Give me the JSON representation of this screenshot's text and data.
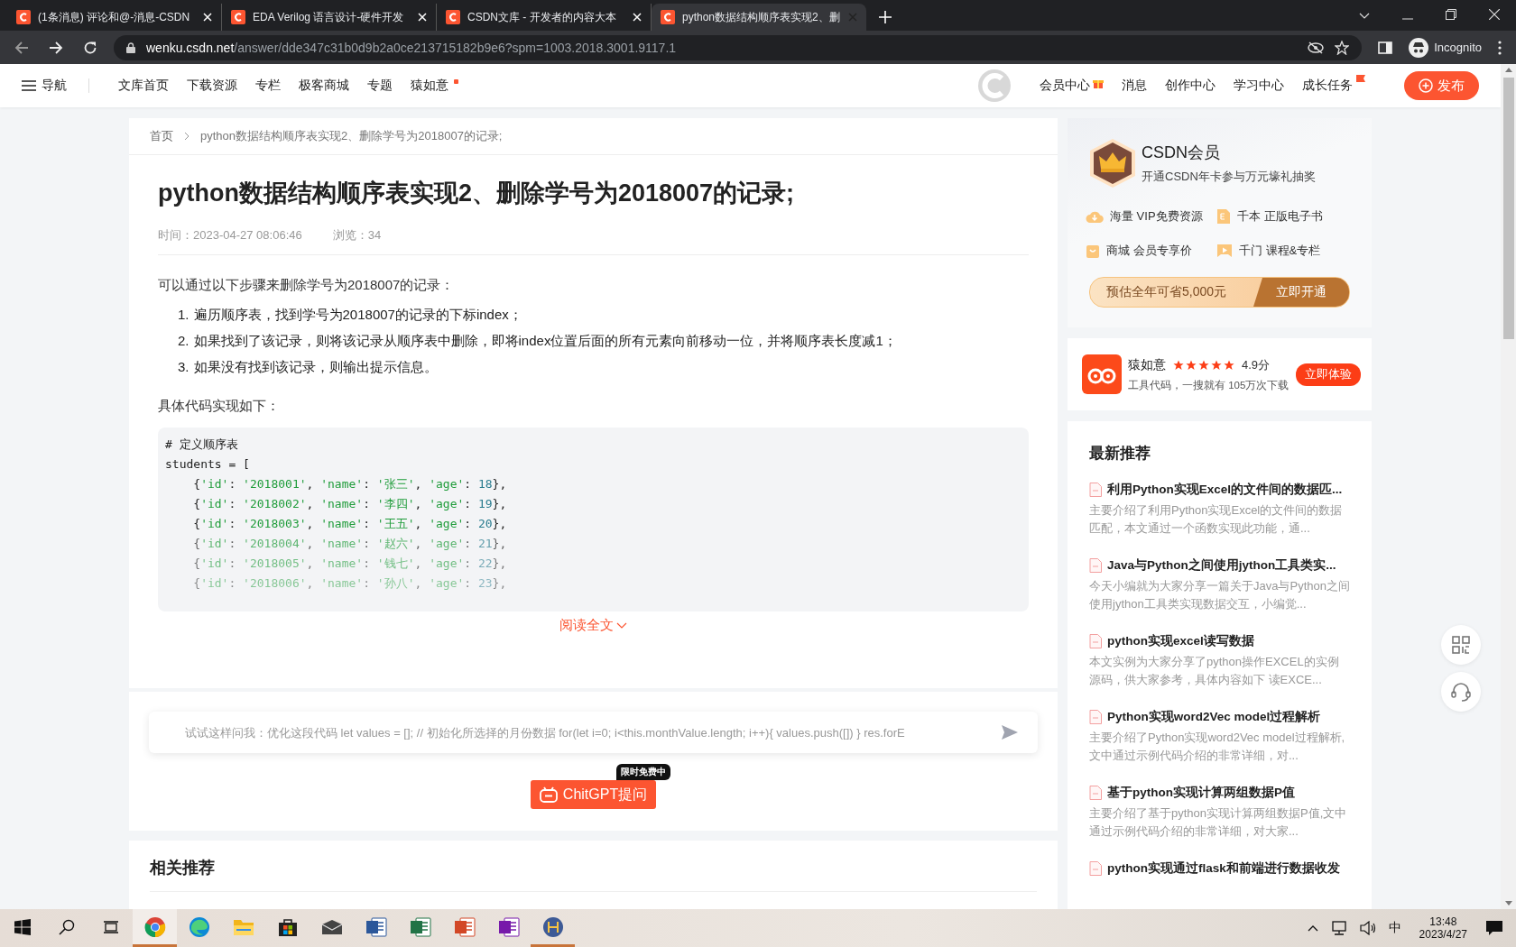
{
  "browser": {
    "tabs": [
      {
        "title": "(1条消息) 评论和@-消息-CSDN",
        "selected": false
      },
      {
        "title": "EDA Verilog 语言设计-硬件开发",
        "selected": false
      },
      {
        "title": "CSDN文库 - 开发者的内容大本",
        "selected": false
      },
      {
        "title": "python数据结构顺序表实现2、删",
        "selected": true
      }
    ],
    "url_host": "wenku.csdn.net",
    "url_path": "/answer/dde347c31b0d9b2a0ce213715182b9e6?spm=1003.2018.3001.9117.1",
    "profile": "Incognito"
  },
  "site_nav": {
    "menu": "导航",
    "links": [
      {
        "label": "文库首页",
        "badge": false
      },
      {
        "label": "下载资源",
        "badge": false
      },
      {
        "label": "专栏",
        "badge": false
      },
      {
        "label": "极客商城",
        "badge": false
      },
      {
        "label": "专题",
        "badge": false
      },
      {
        "label": "猿如意",
        "badge": true
      }
    ],
    "right_links": [
      {
        "label": "会员中心",
        "kind": "gift"
      },
      {
        "label": "消息",
        "kind": "plain"
      },
      {
        "label": "创作中心",
        "kind": "plain"
      },
      {
        "label": "学习中心",
        "kind": "plain"
      },
      {
        "label": "成长任务",
        "kind": "badge"
      }
    ],
    "publish": "发布"
  },
  "breadcrumb": [
    "首页",
    "python数据结构顺序表实现2、删除学号为2018007的记录;"
  ],
  "article": {
    "title": "python数据结构顺序表实现2、删除学号为2018007的记录;",
    "time": "时间：2023-04-27 08:06:46",
    "views": "浏览：34",
    "intro": "可以通过以下步骤来删除学号为2018007的记录：",
    "steps": [
      {
        "number": "1.",
        "text": "遍历顺序表，找到学号为2018007的记录的下标index；"
      },
      {
        "number": "2.",
        "text": "如果找到了该记录，则将该记录从顺序表中删除，即将index位置后面的所有元素向前移动一位，并将顺序表长度减1；"
      },
      {
        "number": "3.",
        "text": "如果没有找到该记录，则输出提示信息。"
      }
    ],
    "code_intro": "具体代码实现如下：",
    "code": [
      "# 定义顺序表",
      "students = [",
      "    {'id': '2018001', 'name': '张三', 'age': 18},",
      "    {'id': '2018002', 'name': '李四', 'age': 19},",
      "    {'id': '2018003', 'name': '王五', 'age': 20},",
      "    {'id': '2018004', 'name': '赵六', 'age': 21},",
      "    {'id': '2018005', 'name': '钱七', 'age': 22},",
      "    {'id': '2018006', 'name': '孙八', 'age': 23},"
    ],
    "read_more": "阅读全文"
  },
  "ask": {
    "placeholder": "试试这样问我：优化这段代码 let values = []; // 初始化所选择的月份数据 for(let i=0; i<this.monthValue.length; i++){ values.push([]) } res.forE",
    "button": "ChitGPT提问",
    "badge": "限时免费中"
  },
  "related": {
    "title": "相关推荐"
  },
  "vip": {
    "title": "CSDN会员",
    "subtitle": "开通CSDN年卡参与万元壕礼抽奖",
    "perks": [
      "海量 VIP免费资源",
      "千本 正版电子书",
      "商城 会员专享价",
      "千门 课程&专栏"
    ],
    "saving": "预估全年可省5,000元",
    "button": "立即开通"
  },
  "app": {
    "name": "猿如意",
    "stars": 5,
    "rating": "4.9分",
    "desc": "工具代码，一搜就有 105万次下载",
    "button": "立即体验"
  },
  "latest": {
    "title": "最新推荐",
    "items": [
      {
        "title": "利用Python实现Excel的文件间的数据匹...",
        "desc": "主要介绍了利用Python实现Excel的文件间的数据匹配，本文通过一个函数实现此功能，通..."
      },
      {
        "title": "Java与Python之间使用jython工具类实...",
        "desc": "今天小编就为大家分享一篇关于Java与Python之间使用jython工具类实现数据交互，小编觉..."
      },
      {
        "title": "python实现excel读写数据",
        "desc": "本文实例为大家分享了python操作EXCEL的实例源码，供大家参考，具体内容如下 读EXCE..."
      },
      {
        "title": "Python实现word2Vec model过程解析",
        "desc": "主要介绍了Python实现word2Vec model过程解析,文中通过示例代码介绍的非常详细，对..."
      },
      {
        "title": "基于python实现计算两组数据P值",
        "desc": "主要介绍了基于python实现计算两组数据P值,文中通过示例代码介绍的非常详细，对大家..."
      },
      {
        "title": "python实现通过flask和前端进行数据收发"
      }
    ]
  },
  "taskbar": {
    "apps": [
      {
        "kind": "windows",
        "selected": false,
        "running": false
      },
      {
        "kind": "search",
        "selected": false,
        "running": false
      },
      {
        "kind": "taskview",
        "selected": false,
        "running": false
      },
      {
        "kind": "chrome",
        "selected": true,
        "running": true
      },
      {
        "kind": "edge",
        "selected": false,
        "running": false
      },
      {
        "kind": "folder",
        "selected": false,
        "running": false
      },
      {
        "kind": "store",
        "selected": false,
        "running": false
      },
      {
        "kind": "mail",
        "selected": false,
        "running": false
      },
      {
        "kind": "word",
        "selected": false,
        "running": false
      },
      {
        "kind": "excel",
        "selected": false,
        "running": false
      },
      {
        "kind": "powerpoint",
        "selected": false,
        "running": false
      },
      {
        "kind": "onenote",
        "selected": false,
        "running": false
      },
      {
        "kind": "hbuilder",
        "selected": false,
        "running": true
      }
    ],
    "ime": "中",
    "time": "13:48",
    "date": "2023/4/27"
  }
}
